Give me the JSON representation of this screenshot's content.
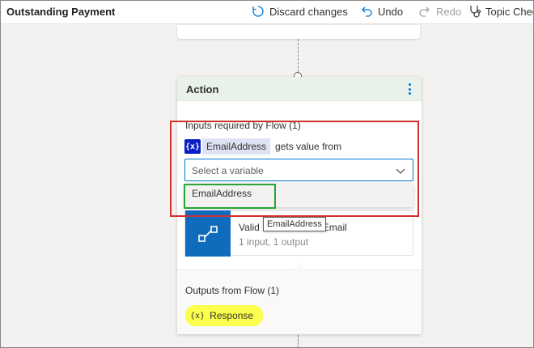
{
  "toolbar": {
    "title": "Outstanding Payment",
    "discard_label": "Discard changes",
    "undo_label": "Undo",
    "redo_label": "Redo",
    "topic_checker_label": "Topic Chec"
  },
  "action_card": {
    "title": "Action",
    "inputs_label": "Inputs required by Flow (1)",
    "input_variable": {
      "icon_text": "{x}",
      "name": "EmailAddress",
      "suffix": "gets value from"
    },
    "select": {
      "placeholder": "Select a variable",
      "option": "EmailAddress"
    },
    "flow": {
      "name_visible": "Valid",
      "name_tail": "Email",
      "meta": "1 input, 1 output",
      "tooltip": "EmailAddress"
    },
    "outputs_label": "Outputs from Flow (1)",
    "output_variable": {
      "icon_text": "{x}",
      "name": "Response"
    }
  },
  "colors": {
    "header_bg": "#e8f1ea",
    "variable_icon": "#0b1fc4",
    "flow_icon": "#0f6cbd",
    "highlight": "#fbff4d",
    "annotation_red": "#d32f2f",
    "annotation_green": "#27a535"
  },
  "icons": {
    "discard": "discard-icon",
    "undo": "undo-icon",
    "redo": "redo-icon",
    "topic_checker": "stethoscope-icon",
    "chevron": "chevron-down-icon",
    "flow": "flow-icon"
  }
}
